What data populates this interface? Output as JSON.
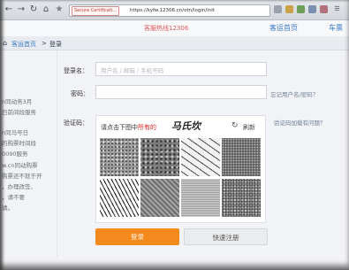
{
  "browser": {
    "security_label": "Secure Certificati...",
    "url": "https://kyfw.12306.cn/otn/login/init",
    "nav_icons": [
      "back-icon",
      "forward-icon",
      "reload-icon",
      "home-icon",
      "star-icon"
    ],
    "nav_glyphs": [
      "←",
      "→",
      "↻",
      "⌂",
      "★"
    ],
    "toolbar_icons": [
      "extension-icon",
      "extension-icon",
      "extension-icon",
      "extension-icon",
      "extension-icon",
      "menu-icon"
    ]
  },
  "header": {
    "hotline": "客服热线12306",
    "nav": [
      "客运首页",
      "车票"
    ]
  },
  "breadcrumb": {
    "home_glyph": "⌂",
    "home": "客运首页",
    "separator": ">",
    "current": "登录"
  },
  "notice_lines": [
    "n同动务3月",
    "日前间段服务",
    "n同马号日",
    "的购票时间段",
    "0090服务",
    "w.cn同动购票",
    "购票还不就于开",
    "，办理改签、",
    "，请不要",
    "请。"
  ],
  "form": {
    "username_label": "登录名：",
    "username_placeholder": "用户名 / 邮箱 / 手机号码",
    "password_label": "密码：",
    "password_value": "",
    "forgot_link": "忘记用户名/密码？",
    "captcha_label": "验证码：",
    "captcha_help_link": "验证码加载有问题？",
    "captcha": {
      "prompt": "请点击下图中",
      "prompt_emphasis": "所有的",
      "target_word": "马氏坎",
      "refresh_glyph": "↻",
      "refresh_label": "刷新"
    },
    "login_button": "登录",
    "register_button": "快速注册"
  },
  "colors": {
    "accent_orange": "#f48a1e",
    "link_blue": "#3b79c4",
    "emphasis_red": "#e02020"
  }
}
